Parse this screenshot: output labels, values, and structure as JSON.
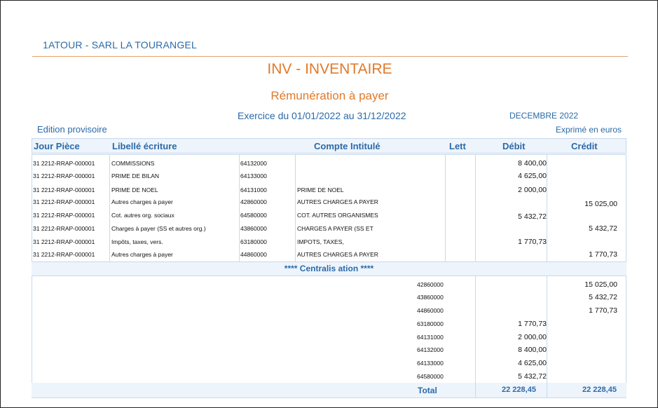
{
  "company": "1ATOUR - SARL LA TOURANGEL",
  "title": "INV - INVENTAIRE",
  "subtitle": "Rémunération à payer",
  "exercice": "Exercice du 01/01/2022 au 31/12/2022",
  "month": "DECEMBRE  2022",
  "edition": "Edition provisoire",
  "exprime": "Exprimé en euros",
  "headers": {
    "jour_piece": "Jour Pièce",
    "libelle": "Libellé écriture",
    "compte": "Compte  Intitulé",
    "lett": "Lett",
    "debit": "Débit",
    "credit": "Crédit"
  },
  "rows": [
    {
      "piece": "31 2212-RRAP-000001",
      "libelle": "COMMISSIONS",
      "compte": "64132000",
      "intitule": "",
      "debit": "8 400,00",
      "credit": ""
    },
    {
      "piece": "31 2212-RRAP-000001",
      "libelle": "PRIME DE BILAN",
      "compte": "64133000",
      "intitule": "",
      "debit": "4 625,00",
      "credit": ""
    },
    {
      "piece": "31 2212-RRAP-000001",
      "libelle": "PRIME DE NOEL",
      "compte": "64131000",
      "intitule": "PRIME DE NOEL",
      "debit": "2 000,00",
      "credit": ""
    },
    {
      "piece": "31 2212-RRAP-000001",
      "libelle": "Autres charges à payer",
      "compte": "42860000",
      "intitule": "AUTRES CHARGES A PAYER",
      "debit": "",
      "credit": "15 025,00"
    },
    {
      "piece": "31 2212-RRAP-000001",
      "libelle": "Cot. autres org. sociaux",
      "compte": "64580000",
      "intitule": "COT. AUTRES ORGANISMES",
      "debit": "5 432,72",
      "credit": ""
    },
    {
      "piece": "31 2212-RRAP-000001",
      "libelle": "Charges à payer (SS et autres org.)",
      "compte": "43860000",
      "intitule": "CHARGES A PAYER (SS ET",
      "debit": "",
      "credit": "5 432,72"
    },
    {
      "piece": "31 2212-RRAP-000001",
      "libelle": "Impôts, taxes, vers.",
      "compte": "63180000",
      "intitule": "IMPOTS, TAXES,",
      "debit": "1 770,73",
      "credit": ""
    },
    {
      "piece": "31 2212-RRAP-000001",
      "libelle": "Autres charges à payer",
      "compte": "44860000",
      "intitule": "AUTRES CHARGES A PAYER",
      "debit": "",
      "credit": "1 770,73"
    }
  ],
  "centralisation_label": "**** Centralis ation ****",
  "centralisation": [
    {
      "compte": "42860000",
      "debit": "",
      "credit": "15 025,00"
    },
    {
      "compte": "43860000",
      "debit": "",
      "credit": "5 432,72"
    },
    {
      "compte": "44860000",
      "debit": "",
      "credit": "1 770,73"
    },
    {
      "compte": "63180000",
      "debit": "1 770,73",
      "credit": ""
    },
    {
      "compte": "64131000",
      "debit": "2 000,00",
      "credit": ""
    },
    {
      "compte": "64132000",
      "debit": "8 400,00",
      "credit": ""
    },
    {
      "compte": "64133000",
      "debit": "4 625,00",
      "credit": ""
    },
    {
      "compte": "64580000",
      "debit": "5 432,72",
      "credit": ""
    }
  ],
  "total": {
    "label": "Total",
    "debit": "22 228,45",
    "credit": "22 228,45"
  }
}
